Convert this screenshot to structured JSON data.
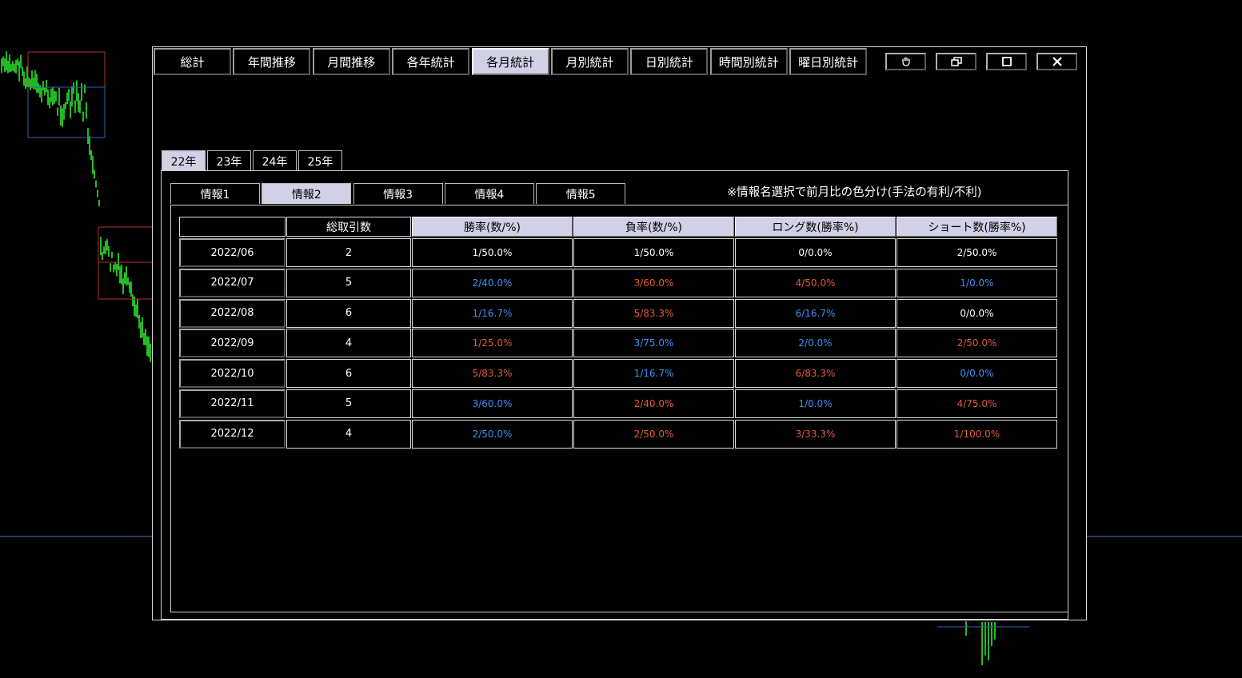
{
  "colors": {
    "up": "#e35a3a",
    "down": "#3f8ef5",
    "neutral": "#ffffff",
    "tab_active": "#d0d0e6",
    "chart_candle": "#2ee82e"
  },
  "top_tabs": [
    "総計",
    "年間推移",
    "月間推移",
    "各年統計",
    "各月統計",
    "月別統計",
    "日別統計",
    "時間別統計",
    "曜日別統計"
  ],
  "top_active": 4,
  "window_buttons": [
    "hand-icon",
    "restore-icon",
    "maximize-icon",
    "close-icon"
  ],
  "year_tabs": [
    "22年",
    "23年",
    "24年",
    "25年"
  ],
  "year_active": 0,
  "info_tabs": [
    "情報1",
    "情報2",
    "情報3",
    "情報4",
    "情報5"
  ],
  "info_active": 1,
  "note": "※情報名選択で前月比の色分け(手法の有利/不利)",
  "table": {
    "headers": [
      "",
      "総取引数",
      "勝率(数/%)",
      "負率(数/%)",
      "ロング数(勝率%)",
      "ショート数(勝率%)"
    ],
    "rows": [
      {
        "month": "2022/06",
        "total": "2",
        "cells": [
          [
            "1/50.0%",
            "n"
          ],
          [
            "1/50.0%",
            "n"
          ],
          [
            "0/0.0%",
            "n"
          ],
          [
            "2/50.0%",
            "n"
          ]
        ]
      },
      {
        "month": "2022/07",
        "total": "5",
        "cells": [
          [
            "2/40.0%",
            "b"
          ],
          [
            "3/60.0%",
            "r"
          ],
          [
            "4/50.0%",
            "r"
          ],
          [
            "1/0.0%",
            "b"
          ]
        ]
      },
      {
        "month": "2022/08",
        "total": "6",
        "cells": [
          [
            "1/16.7%",
            "b"
          ],
          [
            "5/83.3%",
            "r"
          ],
          [
            "6/16.7%",
            "b"
          ],
          [
            "0/0.0%",
            "n"
          ]
        ]
      },
      {
        "month": "2022/09",
        "total": "4",
        "cells": [
          [
            "1/25.0%",
            "r"
          ],
          [
            "3/75.0%",
            "b"
          ],
          [
            "2/0.0%",
            "b"
          ],
          [
            "2/50.0%",
            "r"
          ]
        ]
      },
      {
        "month": "2022/10",
        "total": "6",
        "cells": [
          [
            "5/83.3%",
            "r"
          ],
          [
            "1/16.7%",
            "b"
          ],
          [
            "6/83.3%",
            "r"
          ],
          [
            "0/0.0%",
            "b"
          ]
        ]
      },
      {
        "month": "2022/11",
        "total": "5",
        "cells": [
          [
            "3/60.0%",
            "b"
          ],
          [
            "2/40.0%",
            "r"
          ],
          [
            "1/0.0%",
            "b"
          ],
          [
            "4/75.0%",
            "r"
          ]
        ]
      },
      {
        "month": "2022/12",
        "total": "4",
        "cells": [
          [
            "2/50.0%",
            "b"
          ],
          [
            "2/50.0%",
            "r"
          ],
          [
            "3/33.3%",
            "r"
          ],
          [
            "1/100.0%",
            "r"
          ]
        ]
      }
    ]
  }
}
